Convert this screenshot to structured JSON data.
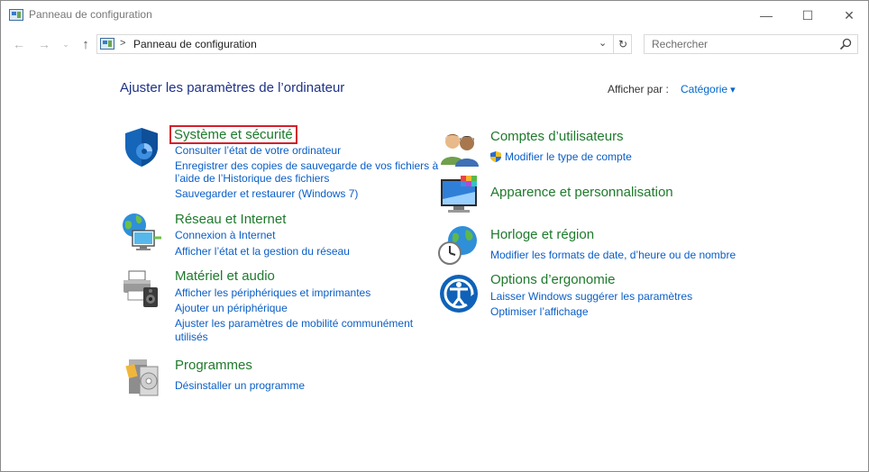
{
  "window": {
    "title": "Panneau de configuration",
    "controls": {
      "minimize": "—",
      "maximize": "☐",
      "close": "✕"
    }
  },
  "nav": {
    "back": "←",
    "forward": "→",
    "recent": "⌄",
    "up": "↑",
    "breadcrumb_sep": ">",
    "address": "Panneau de configuration",
    "address_dropdown": "⌄",
    "refresh": "↻"
  },
  "search": {
    "placeholder": "Rechercher"
  },
  "content": {
    "heading": "Ajuster les paramètres de l’ordinateur",
    "view_by_label": "Afficher par :",
    "view_by_value": "Catégorie"
  },
  "categories": [
    {
      "title": "Système et sécurité",
      "icon": "shield-icon",
      "links": [
        "Consulter l’état de votre ordinateur",
        "Enregistrer des copies de sauvegarde de vos fichiers à",
        "l’aide de l’Historique des fichiers",
        "Sauvegarder et restaurer (Windows 7)"
      ]
    },
    {
      "title": "Réseau et Internet",
      "icon": "network-globe-icon",
      "links": [
        "Connexion à Internet",
        "Afficher l’état et la gestion du réseau"
      ]
    },
    {
      "title": "Matériel et audio",
      "icon": "printer-speaker-icon",
      "links": [
        "Afficher les périphériques et imprimantes",
        "Ajouter un périphérique",
        "Ajuster les paramètres de mobilité communément",
        "utilisés"
      ]
    },
    {
      "title": "Programmes",
      "icon": "programs-disc-icon",
      "links": [
        "Désinstaller un programme"
      ]
    },
    {
      "title": "Comptes d’utilisateurs",
      "icon": "users-icon",
      "links": [
        "Modifier le type de compte"
      ]
    },
    {
      "title": "Apparence et personnalisation",
      "icon": "monitor-palette-icon",
      "links": []
    },
    {
      "title": "Horloge et région",
      "icon": "clock-globe-icon",
      "links": [
        "Modifier les formats de date, d’heure ou de nombre"
      ]
    },
    {
      "title": "Options d’ergonomie",
      "icon": "accessibility-icon",
      "links": [
        "Laisser Windows suggérer les paramètres",
        "Optimiser l’affichage"
      ]
    }
  ]
}
